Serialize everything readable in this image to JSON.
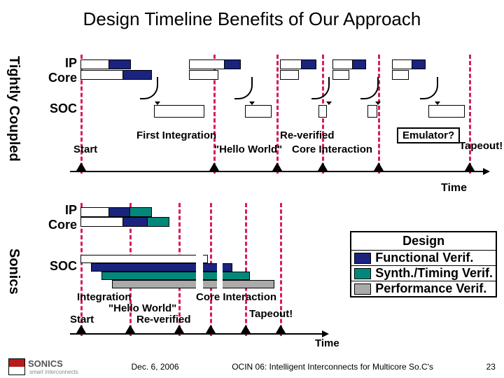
{
  "title": "Design Timeline Benefits of Our Approach",
  "sideLabels": {
    "tc": "Tightly Coupled",
    "sonics": "Sonics"
  },
  "rowLabels": {
    "ip": "IP Core",
    "soc": "SOC"
  },
  "topLabels": {
    "start": "Start",
    "first": "First Integration",
    "hello": "\"Hello World\"",
    "rev": "Re-verified",
    "core": "Core Interaction",
    "emu": "Emulator?",
    "tape": "Tapeout!",
    "time": "Time"
  },
  "bottomLabels": {
    "start": "Start",
    "integ": "Integration",
    "hello": "\"Hello World\"",
    "rev": "Re-verified",
    "core": "Core Interaction",
    "tape": "Tapeout!",
    "time": "Time"
  },
  "legend": {
    "design": "Design",
    "func": "Functional Verif.",
    "synth": "Synth./Timing Verif.",
    "perf": "Performance Verif."
  },
  "footer": {
    "date": "Dec. 6, 2006",
    "event": "OCIN 06: Intelligent Interconnects for Multicore So.C's",
    "page": "23",
    "brand": "SONICS",
    "tagline": "smart interconnects"
  },
  "colors": {
    "navy": "#1a237e",
    "teal": "#00897b",
    "grey": "#aaaaaa",
    "pink": "#d81b60"
  },
  "chart_data": {
    "type": "bar",
    "description": "Two Gantt-style timelines comparing 'Tightly Coupled' vs 'Sonics' approaches across IP Core and SOC rows. Sonics approach reaches milestones earlier.",
    "approaches": [
      {
        "name": "Tightly Coupled",
        "rows": [
          "IP Core",
          "SOC"
        ],
        "milestones": [
          "Start",
          "First Integration",
          "Hello World",
          "Re-verified",
          "Core Interaction",
          "Emulator?",
          "Tapeout!"
        ],
        "milestone_positions_rel": [
          0,
          36,
          52,
          63,
          77,
          90,
          100
        ]
      },
      {
        "name": "Sonics",
        "rows": [
          "IP Core",
          "SOC"
        ],
        "milestones": [
          "Start",
          "Integration",
          "Hello World",
          "Re-verified",
          "Core Interaction",
          "Tapeout!"
        ],
        "milestone_positions_rel": [
          0,
          17,
          33,
          42,
          53,
          63
        ]
      }
    ],
    "phase_legend": [
      "Design",
      "Functional Verif.",
      "Synth./Timing Verif.",
      "Performance Verif."
    ]
  }
}
